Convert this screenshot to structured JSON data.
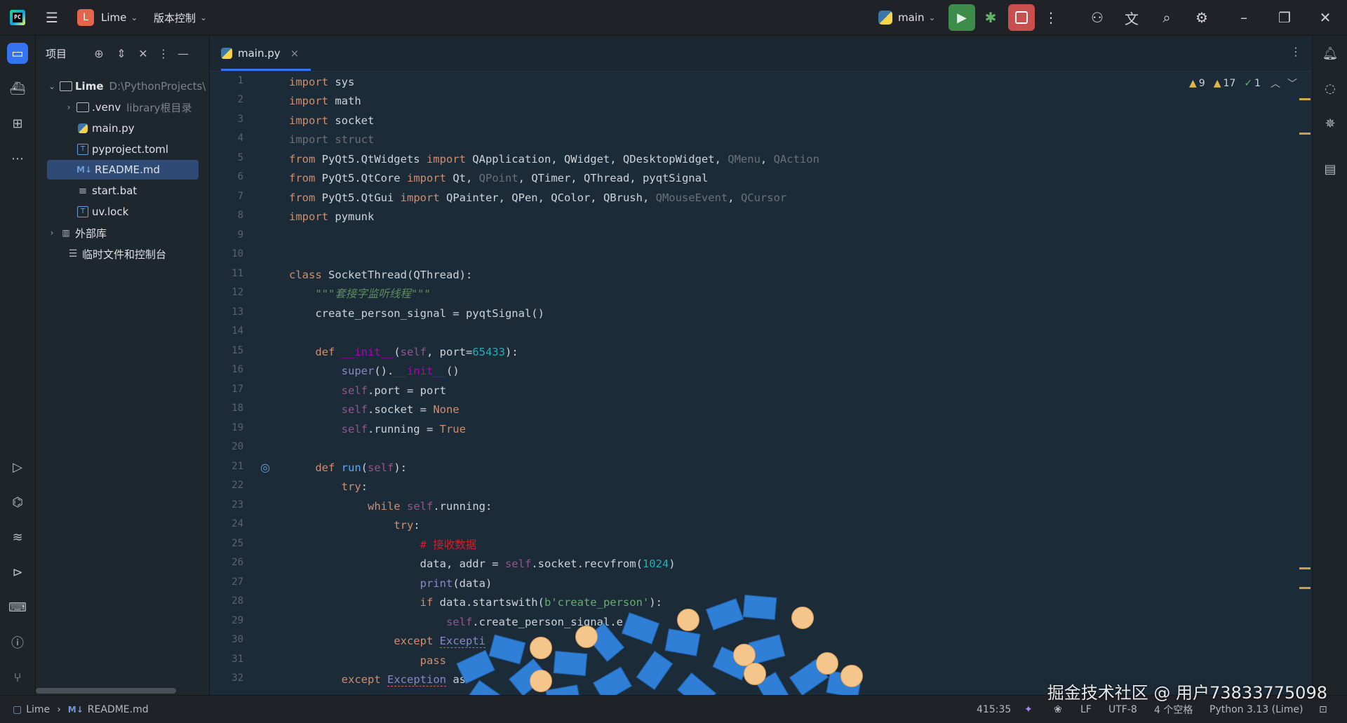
{
  "titlebar": {
    "project_badge": "L",
    "project_name": "Lime",
    "vcs_label": "版本控制",
    "run_config": "main"
  },
  "project_panel": {
    "title": "项目",
    "tree": [
      {
        "label": "Lime",
        "extra": "D:\\PythonProjects\\",
        "icon": "folder-icon",
        "arrow": "⌄"
      },
      {
        "label": ".venv",
        "extra": "library根目录",
        "icon": "folder-icon",
        "arrow": "›"
      },
      {
        "label": "main.py",
        "extra": "",
        "icon": "python-file-icon",
        "arrow": ""
      },
      {
        "label": "pyproject.toml",
        "extra": "",
        "icon": "toml-file-icon",
        "arrow": ""
      },
      {
        "label": "README.md",
        "extra": "",
        "icon": "markdown-file-icon",
        "arrow": ""
      },
      {
        "label": "start.bat",
        "extra": "",
        "icon": "text-file-icon",
        "arrow": ""
      },
      {
        "label": "uv.lock",
        "extra": "",
        "icon": "lock-file-icon",
        "arrow": ""
      },
      {
        "label": "外部库",
        "extra": "",
        "icon": "library-icon",
        "arrow": "›"
      },
      {
        "label": "临时文件和控制台",
        "extra": "",
        "icon": "scratches-icon",
        "arrow": ""
      }
    ]
  },
  "editor": {
    "tab_label": "main.py",
    "tab_close": "×",
    "inspections": {
      "warnings_a": "9",
      "warnings_b": "17",
      "ok": "1"
    }
  },
  "status_bar": {
    "breadcrumb_project": "Lime",
    "breadcrumb_file": "README.md",
    "md_badge": "M↓",
    "position": "415:35",
    "line_sep": "LF",
    "encoding": "UTF-8",
    "indent": "4 个空格",
    "interpreter": "Python 3.13 (Lime)"
  },
  "watermark": "掘金技术社区 @ 用户73833775098"
}
